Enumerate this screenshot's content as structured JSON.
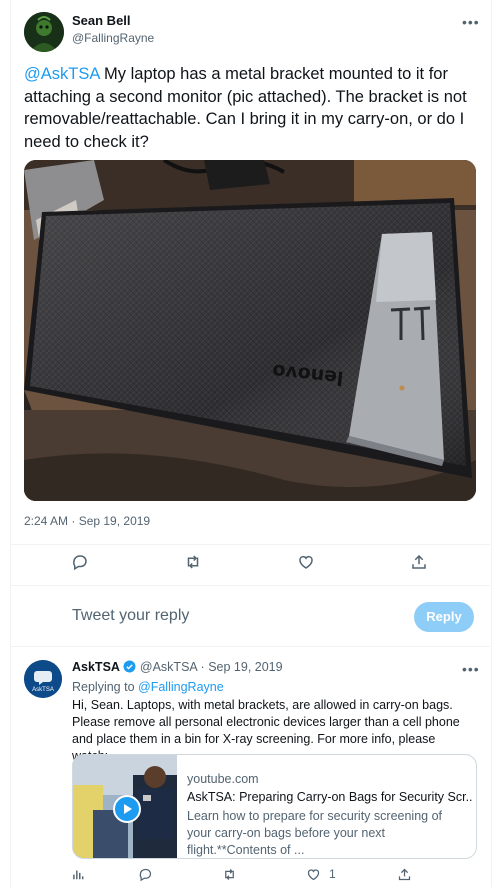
{
  "tweet": {
    "author_name": "Sean Bell",
    "author_handle": "@FallingRayne",
    "mention": "@AskTSA",
    "text": " My laptop has a metal bracket mounted to it for attaching a second monitor (pic attached). The bracket is not removable/reattachable. Can I bring it in my carry-on, or do I need to check it?",
    "timestamp": "2:24 AM · Sep 19, 2019",
    "photo_logo": "lenovo"
  },
  "reply_composer": {
    "placeholder": "Tweet your reply",
    "button_label": "Reply"
  },
  "reply": {
    "author_name": "AskTSA",
    "author_handle": "@AskTSA",
    "dot": "·",
    "date": "Sep 19, 2019",
    "replying_label": "Replying to",
    "replying_to": "@FallingRayne",
    "text": "Hi, Sean. Laptops, with metal brackets, are allowed in carry-on bags. Please remove all personal electronic devices larger than a cell phone and place them in a bin for X-ray screening. For more info, please watch:",
    "avatar_text": "AskTSA",
    "card": {
      "domain": "youtube.com",
      "title": "AskTSA: Preparing Carry-on Bags for Security Scr...",
      "description": "Learn how to prepare for security screening of your carry-on bags before your next flight.**Contents of ..."
    },
    "like_count": "1"
  },
  "colors": {
    "accent": "#1d9bf0",
    "reply_button_disabled": "#8ecdf8"
  }
}
